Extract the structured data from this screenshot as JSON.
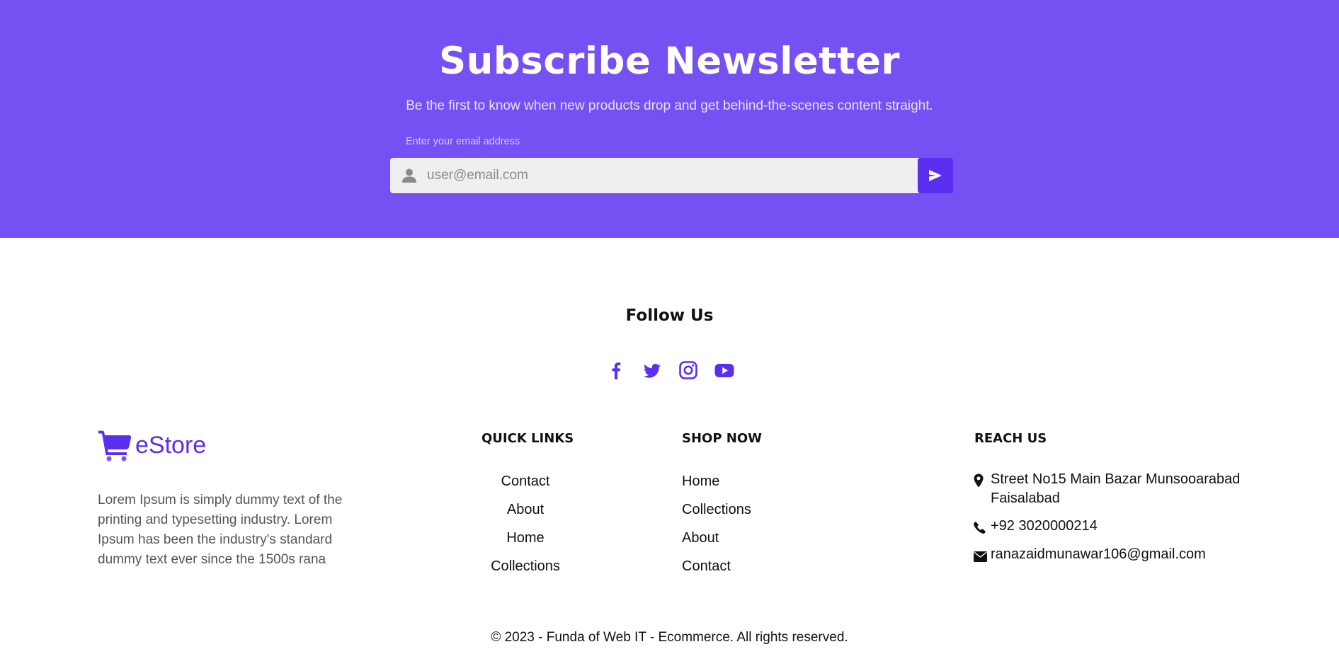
{
  "colors": {
    "newsletter_bg": "#7551f4",
    "accent": "#5a2ff0",
    "text": "#111111",
    "muted": "#555555"
  },
  "newsletter": {
    "title": "Subscribe Newsletter",
    "subtitle": "Be the first to know when new products drop and get behind-the-scenes content straight.",
    "email_label": "Enter your email address",
    "email_placeholder": "user@email.com",
    "email_value": "",
    "input_icon": "user-icon",
    "submit_icon": "send-icon"
  },
  "follow": {
    "title": "Follow Us",
    "icons": [
      "facebook-icon",
      "twitter-icon",
      "instagram-icon",
      "youtube-icon"
    ]
  },
  "brand": {
    "logo_icon": "cart-icon",
    "name": "eStore",
    "description": "Lorem Ipsum is simply dummy text of the printing and typesetting industry. Lorem Ipsum has been the industry's standard dummy text ever since the 1500s rana"
  },
  "quick_links": {
    "heading": "QUICK LINKS",
    "items": [
      "Contact",
      "About",
      "Home",
      "Collections"
    ]
  },
  "shop_now": {
    "heading": "SHOP NOW",
    "items": [
      "Home",
      "Collections",
      "About",
      "Contact"
    ]
  },
  "reach_us": {
    "heading": "REACH US",
    "address": "Street No15 Main Bazar Munsooarabad Faisalabad",
    "phone": "+92 3020000214",
    "email": "ranazaidmunawar106@gmail.com",
    "address_icon": "map-marker-icon",
    "phone_icon": "phone-icon",
    "email_icon": "envelope-icon"
  },
  "footer": {
    "copyright": "© 2023 - Funda of Web IT - Ecommerce. All rights reserved."
  }
}
